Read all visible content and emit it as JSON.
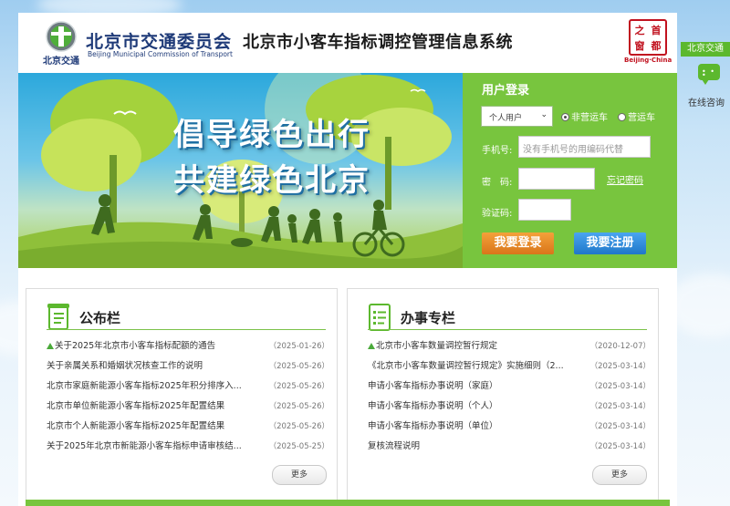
{
  "header": {
    "org_cn": "北京市交通委员会",
    "org_en": "Beijing Municipal Commission of Transport",
    "logo_text": "北京交通",
    "system_title": "北京市小客车指标调控管理信息系统",
    "bj_logo_chars": [
      "之",
      "首",
      "都",
      "窗"
    ],
    "bj_logo_en": "Beijing·China"
  },
  "banner": {
    "line1": "倡导绿色出行",
    "line2": "共建绿色北京"
  },
  "login": {
    "title": "用户登录",
    "user_type": "个人用户",
    "radio_non_operating": "非营运车",
    "radio_operating": "营运车",
    "phone_label": "手机号:",
    "phone_placeholder": "没有手机号的用编码代替",
    "password_label": "密　码:",
    "forgot_password": "忘记密码",
    "captcha_label": "验证码:",
    "login_button": "我要登录",
    "register_button": "我要注册"
  },
  "announcements": {
    "title": "公布栏",
    "more": "更多",
    "items": [
      {
        "title": "关于2025年北京市小客车指标配额的通告",
        "date": "（2025-01-26）",
        "pinned": true
      },
      {
        "title": "关于亲属关系和婚姻状况核查工作的说明",
        "date": "（2025-05-26）",
        "pinned": false
      },
      {
        "title": "北京市家庭新能源小客车指标2025年积分排序入...",
        "date": "（2025-05-26）",
        "pinned": false
      },
      {
        "title": "北京市单位新能源小客车指标2025年配置结果",
        "date": "（2025-05-26）",
        "pinned": false
      },
      {
        "title": "北京市个人新能源小客车指标2025年配置结果",
        "date": "（2025-05-26）",
        "pinned": false
      },
      {
        "title": "关于2025年北京市新能源小客车指标申请审核结...",
        "date": "（2025-05-25）",
        "pinned": false
      }
    ]
  },
  "services": {
    "title": "办事专栏",
    "more": "更多",
    "items": [
      {
        "title": "北京市小客车数量调控暂行规定",
        "date": "（2020-12-07）",
        "pinned": true
      },
      {
        "title": "《北京市小客车数量调控暂行规定》实施细则（2...",
        "date": "（2025-03-14）",
        "pinned": false
      },
      {
        "title": "申请小客车指标办事说明（家庭）",
        "date": "（2025-03-14）",
        "pinned": false
      },
      {
        "title": "申请小客车指标办事说明（个人）",
        "date": "（2025-03-14）",
        "pinned": false
      },
      {
        "title": "申请小客车指标办事说明（单位）",
        "date": "（2025-03-14）",
        "pinned": false
      },
      {
        "title": "复核流程说明",
        "date": "（2025-03-14）",
        "pinned": false
      }
    ]
  },
  "side_widget": {
    "header": "北京交通",
    "label": "在线咨询",
    "icon": "chat-bubble-icon"
  },
  "colors": {
    "green": "#78c53e",
    "navy": "#1e3a78",
    "orange": "#e08624",
    "blue": "#2c86d6"
  }
}
